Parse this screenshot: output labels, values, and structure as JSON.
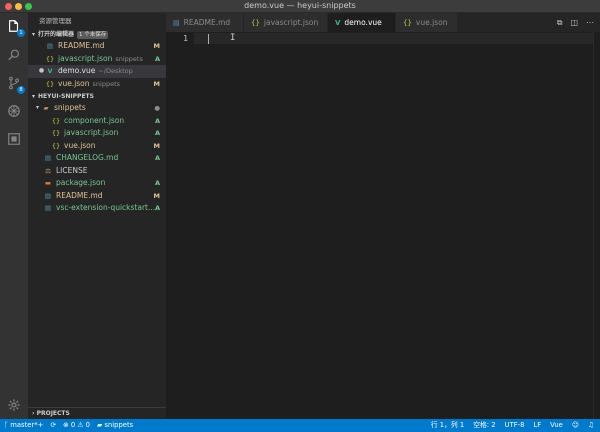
{
  "window": {
    "title": "demo.vue — heyui-snippets",
    "traffic_lights": [
      "#fc605b",
      "#fdbc40",
      "#34c84a"
    ]
  },
  "activity_bar": {
    "badges": {
      "explorer": "1",
      "scm": "8"
    }
  },
  "sidebar": {
    "title": "资源管理器",
    "open_editors": {
      "label": "打开的编辑器",
      "badge": "1 个未保存",
      "items": [
        {
          "name": "README.md",
          "desc": "",
          "status": "M",
          "icon": "md"
        },
        {
          "name": "javascript.json",
          "desc": "snippets",
          "status": "A",
          "icon": "{}"
        },
        {
          "name": "demo.vue",
          "desc": "~/Desktop",
          "status": "",
          "icon": "V"
        },
        {
          "name": "vue.json",
          "desc": "snippets",
          "status": "M",
          "icon": "{}"
        }
      ]
    },
    "folder": {
      "label": "HEYUI-SNIPPETS",
      "items": [
        {
          "name": "snippets",
          "status": "●",
          "icon": "folder"
        },
        {
          "name": "component.json",
          "status": "A",
          "icon": "{}"
        },
        {
          "name": "javascript.json",
          "status": "A",
          "icon": "{}"
        },
        {
          "name": "vue.json",
          "status": "M",
          "icon": "{}"
        },
        {
          "name": "CHANGELOG.md",
          "status": "A",
          "icon": "md"
        },
        {
          "name": "LICENSE",
          "status": "",
          "icon": "license"
        },
        {
          "name": "package.json",
          "status": "A",
          "icon": "{}"
        },
        {
          "name": "README.md",
          "status": "M",
          "icon": "md"
        },
        {
          "name": "vsc-extension-quickstart...",
          "status": "A",
          "icon": "md"
        }
      ]
    },
    "projects_label": "PROJECTS"
  },
  "tabs": [
    {
      "label": "README.md",
      "icon": "md"
    },
    {
      "label": "javascript.json",
      "icon": "{}"
    },
    {
      "label": "demo.vue",
      "icon": "V"
    },
    {
      "label": "vue.json",
      "icon": "{}"
    }
  ],
  "editor": {
    "line_number": "1"
  },
  "statusbar": {
    "branch": "master*+",
    "errors": "0",
    "warnings": "0",
    "workspace": "snippets",
    "position": "行 1，列 1",
    "indent": "空格: 2",
    "encoding": "UTF-8",
    "eol": "LF",
    "language": "Vue"
  }
}
